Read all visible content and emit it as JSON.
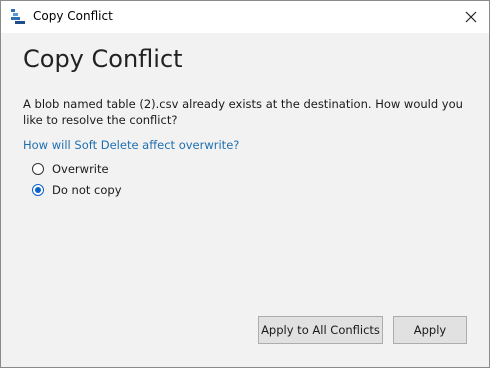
{
  "window": {
    "title": "Copy Conflict",
    "app_icon": "azure-storage-explorer-icon",
    "close_icon": "close-icon"
  },
  "dialog": {
    "heading": "Copy Conflict",
    "message": "A blob named table (2).csv already exists at the destination. How would you like to resolve the conflict?",
    "help_link": "How will Soft Delete affect overwrite?",
    "options": [
      {
        "label": "Overwrite",
        "checked": false
      },
      {
        "label": "Do not copy",
        "checked": true
      }
    ]
  },
  "buttons": {
    "apply_all_label": "Apply to All Conflicts",
    "apply_label": "Apply"
  },
  "colors": {
    "link": "#1f6fb0",
    "radio_accent": "#0a64c8",
    "background": "#f2f2f2"
  }
}
